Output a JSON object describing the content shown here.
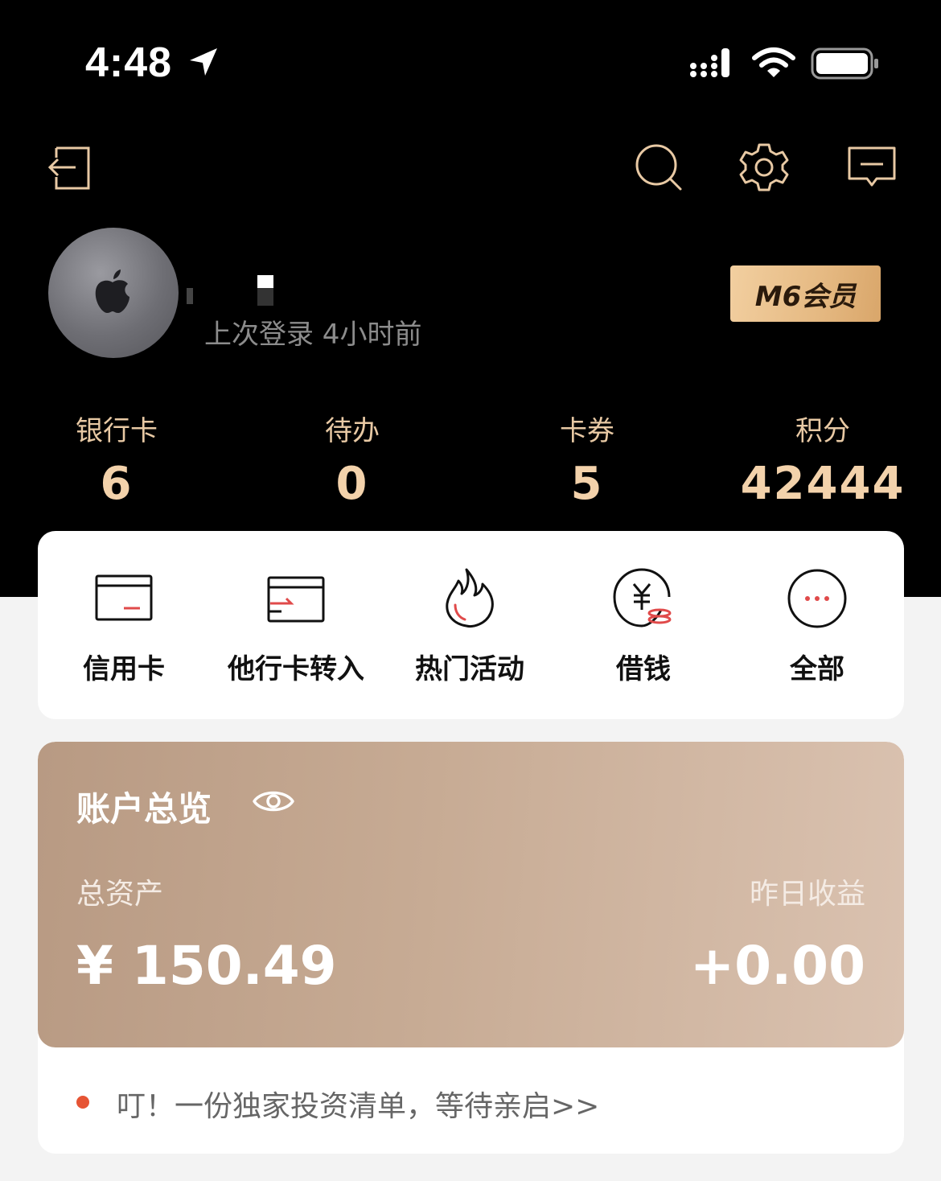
{
  "status_bar": {
    "time": "4:48",
    "icons": [
      "location-arrow-icon",
      "cellular-signal-icon",
      "wifi-icon",
      "battery-icon"
    ]
  },
  "header": {
    "icons": [
      "logout-icon",
      "search-icon",
      "settings-icon",
      "message-icon"
    ],
    "accent_color": "#e8c9a4"
  },
  "profile": {
    "last_login": "上次登录 4小时前",
    "vip_badge": "M6会员"
  },
  "stats": [
    {
      "label": "银行卡",
      "value": "6"
    },
    {
      "label": "待办",
      "value": "0"
    },
    {
      "label": "卡券",
      "value": "5"
    },
    {
      "label": "积分",
      "value": "42444"
    }
  ],
  "quick_actions": [
    {
      "label": "信用卡",
      "icon": "credit-card-icon"
    },
    {
      "label": "他行卡转入",
      "icon": "card-transfer-icon"
    },
    {
      "label": "热门活动",
      "icon": "flame-icon"
    },
    {
      "label": "借钱",
      "icon": "yen-coin-icon"
    },
    {
      "label": "全部",
      "icon": "more-icon"
    }
  ],
  "account": {
    "title": "账户总览",
    "total_assets_label": "总资产",
    "total_assets_value": "¥ 150.49",
    "yesterday_label": "昨日收益",
    "yesterday_value": "+0.00"
  },
  "promo": {
    "text": "叮！一份独家投资清单，等待亲启>>"
  }
}
